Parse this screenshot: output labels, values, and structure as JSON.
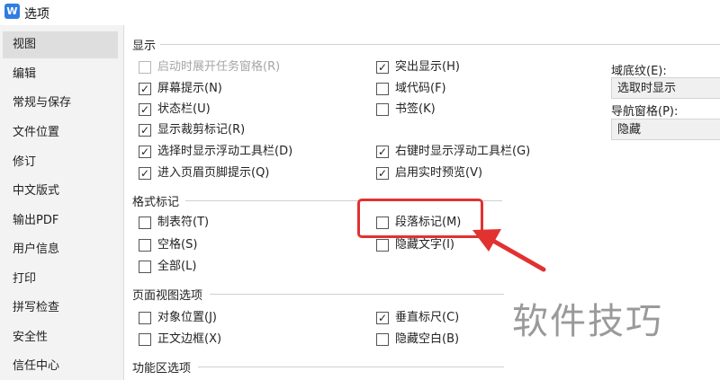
{
  "window": {
    "title": "选项",
    "app_icon_glyph": "W"
  },
  "sidebar": {
    "items": [
      {
        "label": "视图",
        "active": true
      },
      {
        "label": "编辑"
      },
      {
        "label": "常规与保存"
      },
      {
        "label": "文件位置"
      },
      {
        "label": "修订"
      },
      {
        "label": "中文版式"
      },
      {
        "label": "输出PDF"
      },
      {
        "label": "用户信息"
      },
      {
        "label": "打印"
      },
      {
        "label": "拼写检查"
      },
      {
        "label": "安全性"
      },
      {
        "label": "信任中心"
      }
    ]
  },
  "display": {
    "title": "显示",
    "left": [
      {
        "label": "启动时展开任务窗格(R)",
        "checked": false,
        "disabled": true
      },
      {
        "label": "屏幕提示(N)",
        "checked": true
      },
      {
        "label": "状态栏(U)",
        "checked": true
      },
      {
        "label": "显示裁剪标记(R)",
        "checked": true
      },
      {
        "label": "选择时显示浮动工具栏(D)",
        "checked": true
      },
      {
        "label": "进入页眉页脚提示(Q)",
        "checked": true
      }
    ],
    "right": [
      {
        "label": "突出显示(H)",
        "checked": true
      },
      {
        "label": "域代码(F)",
        "checked": false
      },
      {
        "label": "书签(K)",
        "checked": false
      },
      {
        "label": "右键时显示浮动工具栏(G)",
        "checked": true
      },
      {
        "label": "启用实时预览(V)",
        "checked": true
      }
    ],
    "field_shading_label": "域底纹(E):",
    "field_shading_value": "选取时显示",
    "nav_pane_label": "导航窗格(P):",
    "nav_pane_value": "隐藏"
  },
  "format_marks": {
    "title": "格式标记",
    "left": [
      {
        "label": "制表符(T)",
        "checked": false
      },
      {
        "label": "空格(S)",
        "checked": false
      },
      {
        "label": "全部(L)",
        "checked": false
      }
    ],
    "right": [
      {
        "label": "段落标记(M)",
        "checked": false
      },
      {
        "label": "隐藏文字(I)",
        "checked": false
      }
    ]
  },
  "page_view": {
    "title": "页面视图选项",
    "left": [
      {
        "label": "对象位置(J)",
        "checked": false
      },
      {
        "label": "正文边框(X)",
        "checked": false
      }
    ],
    "right": [
      {
        "label": "垂直标尺(C)",
        "checked": true
      },
      {
        "label": "隐藏空白(B)",
        "checked": false
      }
    ]
  },
  "ribbon": {
    "title": "功能区选项"
  },
  "watermark": "软件技巧",
  "colors": {
    "highlight": "#e23131",
    "accent": "#2f7de1"
  }
}
